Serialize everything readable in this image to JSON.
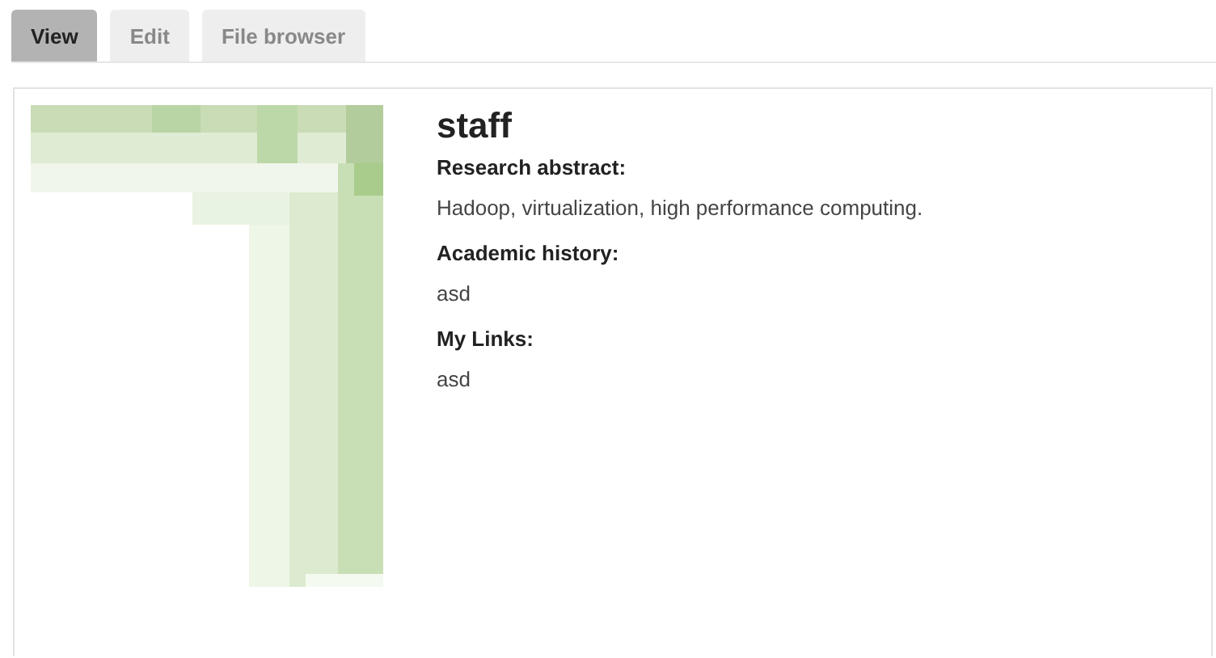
{
  "tabs": [
    {
      "label": "View",
      "selected": true
    },
    {
      "label": "Edit",
      "selected": false
    },
    {
      "label": "File browser",
      "selected": false
    }
  ],
  "profile": {
    "name": "staff",
    "fields": [
      {
        "label": "Research abstract:",
        "value": "Hadoop, virtualization, high performance computing."
      },
      {
        "label": "Academic history:",
        "value": "asd"
      },
      {
        "label": "My Links:",
        "value": "asd"
      }
    ]
  }
}
